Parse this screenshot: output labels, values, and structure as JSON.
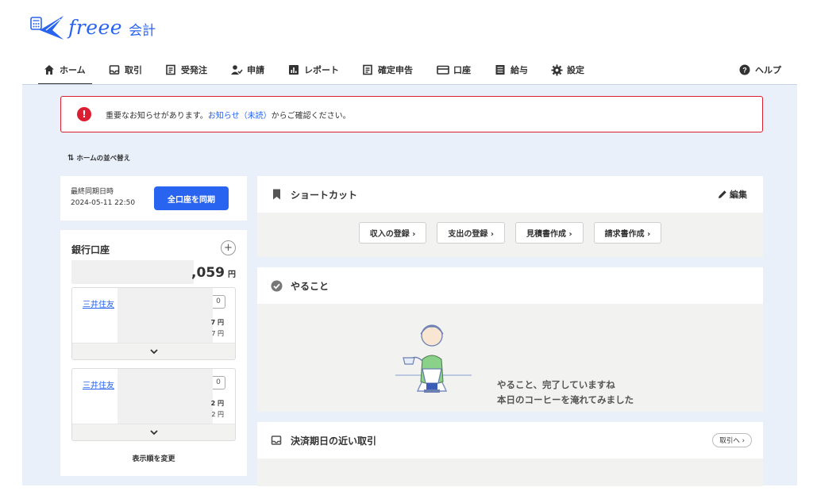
{
  "app": {
    "logo_text": "freee",
    "logo_sub": "会計",
    "brand_color": "#2864f0",
    "alert_color": "#dc1e32"
  },
  "nav": {
    "home": "ホーム",
    "deals": "取引",
    "orders": "受発注",
    "apply": "申請",
    "reports": "レポート",
    "tax": "確定申告",
    "accounts": "口座",
    "payroll": "給与",
    "settings": "設定",
    "help": "ヘルプ"
  },
  "alert": {
    "icon": "exclamation-icon",
    "before": "重要なお知らせがあります。",
    "link": "お知らせ（未読）",
    "after": "からご確認ください。"
  },
  "sort_label": "ホームの並べ替え",
  "sync": {
    "label": "最終同期日時",
    "datetime": "2024-05-11 22:50",
    "button": "全口座を同期"
  },
  "bank": {
    "title": "銀行口座",
    "plus": "+",
    "total_suffix": ",059",
    "yen": "円",
    "accounts": [
      {
        "name": "三井住友",
        "badge": "0",
        "amt1": "7 円",
        "amt2": "7 円"
      },
      {
        "name": "三井住友",
        "badge": "0",
        "amt1": "2 円",
        "amt2": "2 円"
      }
    ],
    "order_label": "表示順を変更"
  },
  "shortcut": {
    "title": "ショートカット",
    "edit": "編集",
    "chips": [
      "収入の登録 ›",
      "支出の登録 ›",
      "見積書作成 ›",
      "請求書作成 ›"
    ]
  },
  "todo": {
    "title": "やること",
    "line1": "やること、完了していますね",
    "line2": "本日のコーヒーを淹れてみました"
  },
  "deals": {
    "title": "決済期日の近い取引",
    "link": "取引へ ›"
  }
}
